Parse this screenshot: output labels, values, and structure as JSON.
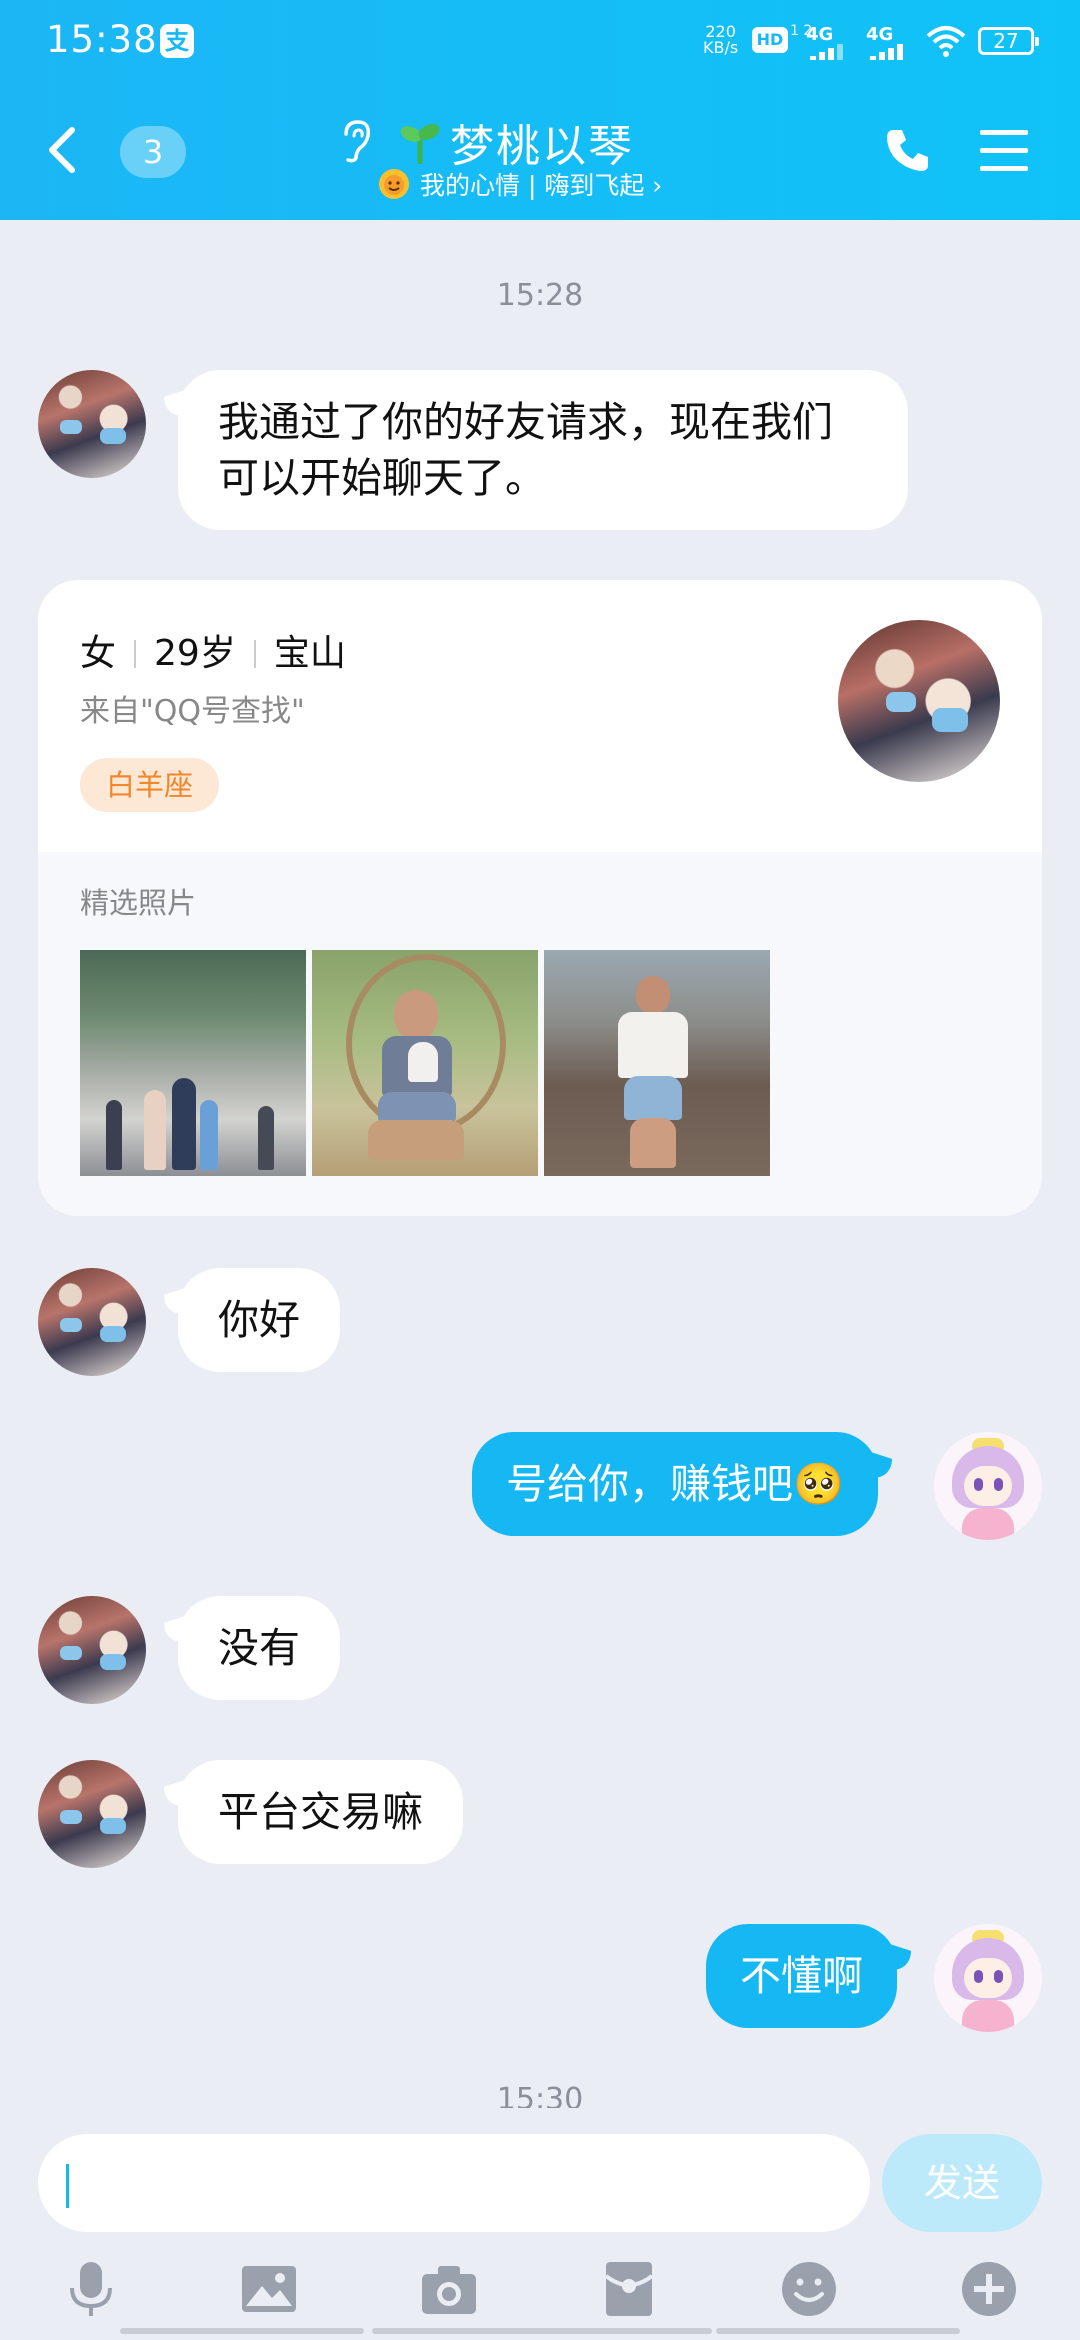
{
  "status_bar": {
    "time": "15:38",
    "pay_icon_char": "支",
    "net_speed_top": "220",
    "net_speed_unit": "KB/s",
    "hd_label": "HD",
    "hd_sub": "1 2",
    "sim1": "4G",
    "sim2": "4G",
    "battery": "27"
  },
  "header": {
    "unread_count": "3",
    "title": "梦桃以琴",
    "subtitle": "我的心情 | 嗨到飞起 ›"
  },
  "messages": {
    "timestamp_1": "15:28",
    "msg_1": "我通过了你的好友请求，现在我们可以开始聊天了。",
    "msg_2": "你好",
    "msg_3": "号给你，赚钱吧",
    "msg_3_emoji": "🥺",
    "msg_4": "没有",
    "msg_5": "平台交易嘛",
    "msg_6": "不懂啊",
    "timestamp_2": "15:30"
  },
  "profile_card": {
    "gender": "女",
    "age": "29岁",
    "location": "宝山",
    "source": "来自\"QQ号查找\"",
    "zodiac_tag": "白羊座",
    "photos_label": "精选照片"
  },
  "input_bar": {
    "send_label": "发送",
    "tools": [
      "mic-icon",
      "image-icon",
      "camera-icon",
      "red-packet-icon",
      "emoji-icon",
      "plus-icon"
    ]
  },
  "colors": {
    "header_blue": "#1cb6f5",
    "outgoing_bubble": "#16b8f3",
    "background": "#eaedf4",
    "tag_orange": "#f0882b"
  }
}
